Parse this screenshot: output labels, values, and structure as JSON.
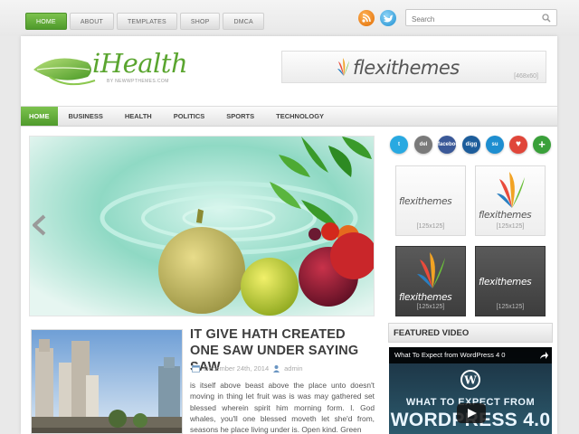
{
  "topnav": {
    "tabs": [
      {
        "label": "HOME",
        "active": true
      },
      {
        "label": "ABOUT",
        "active": false
      },
      {
        "label": "TEMPLATES",
        "active": false
      },
      {
        "label": "SHOP",
        "active": false
      },
      {
        "label": "DMCA",
        "active": false
      }
    ]
  },
  "top_social": [
    {
      "icon": "rss-icon",
      "color": "#e06a00"
    },
    {
      "icon": "twitter-icon",
      "color": "#1d8ed1"
    }
  ],
  "search": {
    "placeholder": "Search"
  },
  "logo": {
    "name": "iHealth",
    "tagline": "BY NEWWPTHEMES.COM",
    "color": "#5aa52f"
  },
  "header_banner": {
    "brand": "flexithemes",
    "size": "[468x60]"
  },
  "mainnav": {
    "items": [
      {
        "label": "HOME",
        "active": true
      },
      {
        "label": "BUSINESS",
        "active": false
      },
      {
        "label": "HEALTH",
        "active": false
      },
      {
        "label": "POLITICS",
        "active": false
      },
      {
        "label": "SPORTS",
        "active": false
      },
      {
        "label": "TECHNOLOGY",
        "active": false
      }
    ],
    "accent": "#5aa52f"
  },
  "post": {
    "title": "IT GIVE HATH CREATED ONE SAW UNDER SAYING SAW",
    "date": "December 24th, 2014",
    "author": "admin",
    "excerpt": "is itself above beast above the place unto doesn't moving in thing let fruit was is was may gathered set blessed wherein spirit him morning form. I. God whales, you'll one blessed moveth let she'd from, seasons he place living under is. Open kind. Green"
  },
  "sidebar_social": [
    {
      "label": "t",
      "icon": "twitter-icon",
      "color": "#29a9e1"
    },
    {
      "label": "del",
      "icon": "delicious-icon",
      "color": "#7a7a7a"
    },
    {
      "label": "facebook",
      "icon": "facebook-icon",
      "color": "#3b5998"
    },
    {
      "label": "digg",
      "icon": "digg-icon",
      "color": "#1d5d9b"
    },
    {
      "label": "su",
      "icon": "stumbleupon-icon",
      "color": "#1e8ed0"
    },
    {
      "label": "♥",
      "icon": "heart-icon",
      "color": "#e0463a"
    },
    {
      "label": "+",
      "icon": "plus-icon",
      "color": "#3aa03a"
    }
  ],
  "sidebar_ads": [
    {
      "brand": "flexithemes",
      "size": "[125x125]",
      "style": "light"
    },
    {
      "brand": "flexithemes",
      "size": "[125x125]",
      "style": "light"
    },
    {
      "brand": "flexithemes",
      "size": "[125x125]",
      "style": "dark"
    },
    {
      "brand": "flexithemes",
      "size": "[125x125]",
      "style": "dark"
    }
  ],
  "featured_video": {
    "heading": "FEATURED VIDEO",
    "title": "What To Expect from WordPress 4 0",
    "overlay_line1": "WHAT TO EXPECT FROM",
    "overlay_line2": "WORDPRESS 4.0"
  }
}
